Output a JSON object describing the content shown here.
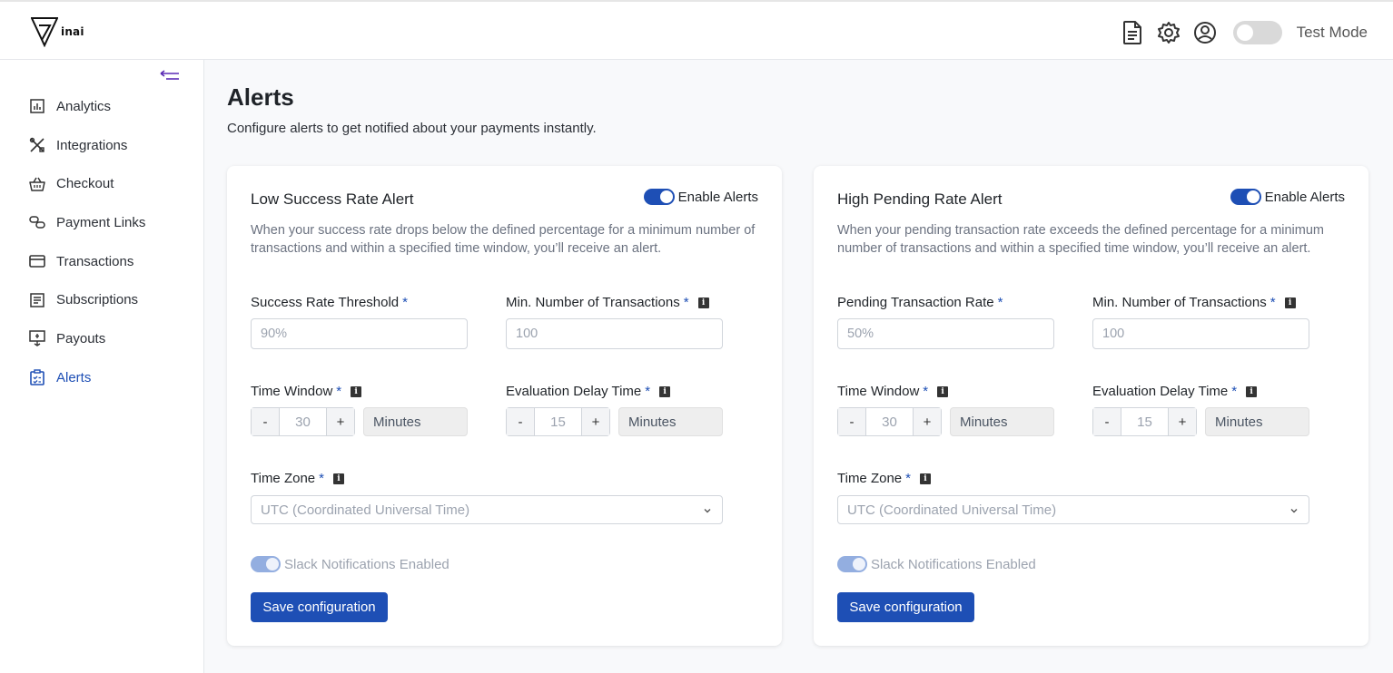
{
  "brand": {
    "name": "inai"
  },
  "header": {
    "icons": [
      "document-icon",
      "gear-icon",
      "user-circle-icon"
    ],
    "test_mode_label": "Test Mode",
    "test_mode_on": false
  },
  "sidebar": {
    "items": [
      {
        "label": "Analytics",
        "icon": "bar-chart-icon",
        "active": false
      },
      {
        "label": "Integrations",
        "icon": "tools-icon",
        "active": false
      },
      {
        "label": "Checkout",
        "icon": "basket-icon",
        "active": false
      },
      {
        "label": "Payment Links",
        "icon": "link-icon",
        "active": false
      },
      {
        "label": "Transactions",
        "icon": "card-icon",
        "active": false
      },
      {
        "label": "Subscriptions",
        "icon": "receipt-icon",
        "active": false
      },
      {
        "label": "Payouts",
        "icon": "payout-icon",
        "active": false
      },
      {
        "label": "Alerts",
        "icon": "clipboard-check-icon",
        "active": true
      }
    ]
  },
  "page": {
    "title": "Alerts",
    "subtitle": "Configure alerts to get notified about your payments instantly."
  },
  "cards": [
    {
      "title": "Low Success Rate Alert",
      "enable_label": "Enable Alerts",
      "description": "When your success rate drops below the defined percentage for a minimum number of transactions and within a specified time window, you’ll receive an alert.",
      "field1_label": "Success Rate Threshold",
      "field1_placeholder": "90%",
      "field2_label": "Min. Number of Transactions",
      "field2_placeholder": "100",
      "time_window_label": "Time Window",
      "time_window_minus": "-",
      "time_window_value": "30",
      "time_window_plus": "+",
      "time_window_unit": "Minutes",
      "eval_delay_label": "Evaluation Delay Time",
      "eval_delay_minus": "-",
      "eval_delay_value": "15",
      "eval_delay_plus": "+",
      "eval_delay_unit": "Minutes",
      "time_zone_label": "Time Zone",
      "time_zone_value": "UTC (Coordinated Universal Time)",
      "slack_label": "Slack Notifications Enabled",
      "save_label": "Save configuration",
      "required_mark": "*"
    },
    {
      "title": "High Pending Rate Alert",
      "enable_label": "Enable Alerts",
      "description": "When your pending transaction rate exceeds the defined percentage for a minimum number of transactions and within a specified time window, you’ll receive an alert.",
      "field1_label": "Pending Transaction Rate",
      "field1_placeholder": "50%",
      "field2_label": "Min. Number of Transactions",
      "field2_placeholder": "100",
      "time_window_label": "Time Window",
      "time_window_minus": "-",
      "time_window_value": "30",
      "time_window_plus": "+",
      "time_window_unit": "Minutes",
      "eval_delay_label": "Evaluation Delay Time",
      "eval_delay_minus": "-",
      "eval_delay_value": "15",
      "eval_delay_plus": "+",
      "eval_delay_unit": "Minutes",
      "time_zone_label": "Time Zone",
      "time_zone_value": "UTC (Coordinated Universal Time)",
      "slack_label": "Slack Notifications Enabled",
      "save_label": "Save configuration",
      "required_mark": "*"
    }
  ],
  "info_glyph": "i",
  "colors": {
    "accent": "#1e4fb5",
    "collapse_arrow": "#5b2bb5"
  }
}
